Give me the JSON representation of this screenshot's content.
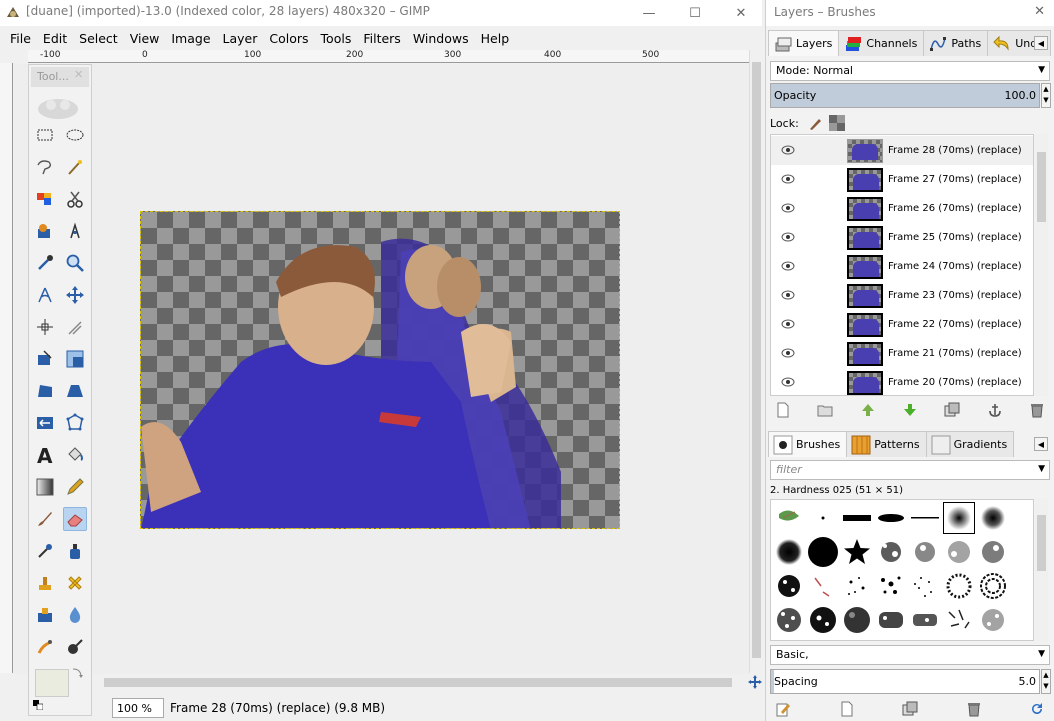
{
  "window": {
    "title": "[duane] (imported)-13.0 (Indexed color, 28 layers) 480x320 – GIMP",
    "minimize": "—",
    "maximize": "☐",
    "close": "✕"
  },
  "menu": [
    "File",
    "Edit",
    "Select",
    "View",
    "Image",
    "Layer",
    "Colors",
    "Tools",
    "Filters",
    "Windows",
    "Help"
  ],
  "ruler_labels": [
    "-100",
    "0",
    "100",
    "200",
    "300",
    "400",
    "500"
  ],
  "toolbox": {
    "title": "Tool...",
    "close": "✕",
    "tools": [
      "rect-select",
      "ellipse-select",
      "free-select",
      "fuzzy-select",
      "by-color-select",
      "scissors-select",
      "foreground-select",
      "paths",
      "color-picker",
      "zoom",
      "measure",
      "move",
      "align",
      "crop",
      "unified-transform",
      "rotate",
      "perspective",
      "flip",
      "cage",
      "text",
      "bucket-fill",
      "gradient",
      "pencil",
      "paintbrush",
      "eraser",
      "airbrush",
      "ink",
      "clone",
      "heal",
      "smudge",
      "dodge-burn",
      "mypaint"
    ]
  },
  "statusbar": {
    "zoom": "100 %",
    "text": "Frame 28 (70ms) (replace) (9.8 MB)"
  },
  "dock": {
    "title": "Layers – Brushes",
    "close": "✕",
    "tabs": [
      {
        "label": "Layers",
        "icon": "layers-icon"
      },
      {
        "label": "Channels",
        "icon": "channels-icon"
      },
      {
        "label": "Paths",
        "icon": "paths-icon"
      },
      {
        "label": "Undo",
        "icon": "undo-icon"
      }
    ],
    "mode_label": "Mode:",
    "mode_value": "Normal",
    "opacity_label": "Opacity",
    "opacity_value": "100.0",
    "lock_label": "Lock:",
    "layers": [
      "Frame 28 (70ms) (replace)",
      "Frame 27 (70ms) (replace)",
      "Frame 26 (70ms) (replace)",
      "Frame 25 (70ms) (replace)",
      "Frame 24 (70ms) (replace)",
      "Frame 23 (70ms) (replace)",
      "Frame 22 (70ms) (replace)",
      "Frame 21 (70ms) (replace)",
      "Frame 20 (70ms) (replace)"
    ],
    "brush_tabs": [
      {
        "label": "Brushes"
      },
      {
        "label": "Patterns"
      },
      {
        "label": "Gradients"
      }
    ],
    "filter_placeholder": "filter",
    "brush_name": "2. Hardness 025 (51 × 51)",
    "brush_set": "Basic,",
    "spacing_label": "Spacing",
    "spacing_value": "5.0"
  }
}
